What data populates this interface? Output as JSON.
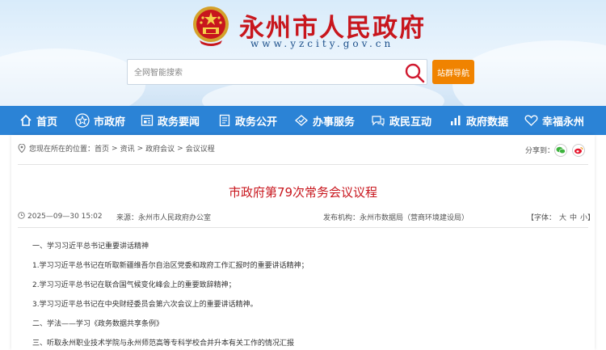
{
  "header": {
    "site_name": "永州市人民政府",
    "site_domain": "www.yzcity.gov.cn",
    "search_placeholder": "全网智能搜索",
    "site_nav_button": "站群导航"
  },
  "nav": [
    {
      "label": "首页",
      "icon": "home-icon"
    },
    {
      "label": "市政府",
      "icon": "star-icon"
    },
    {
      "label": "政务要闻",
      "icon": "news-icon"
    },
    {
      "label": "政务公开",
      "icon": "document-icon"
    },
    {
      "label": "办事服务",
      "icon": "service-icon"
    },
    {
      "label": "政民互动",
      "icon": "chat-icon"
    },
    {
      "label": "政府数据",
      "icon": "data-icon"
    },
    {
      "label": "幸福永州",
      "icon": "heart-icon"
    }
  ],
  "breadcrumb": {
    "prefix": "您现在所在的位置：",
    "items": [
      "首页",
      "资讯",
      "政府会议",
      "会议议程"
    ]
  },
  "share": {
    "label": "分享到："
  },
  "article": {
    "title": "市政府第79次常务会议议程",
    "date": "2025—09—30 15:02",
    "source_label": "来源：",
    "source": "永州市人民政府办公室",
    "publisher_label": "发布机构：",
    "publisher": "永州市数据局（营商环境建设局）",
    "font_label": "【字体：",
    "font_large": "大",
    "font_medium": "中",
    "font_small": "小】",
    "paragraphs": [
      "一、学习习近平总书记重要讲话精神",
      "1.学习习近平总书记在听取新疆维吾尔自治区党委和政府工作汇报时的重要讲话精神；",
      "2.学习习近平总书记在联合国气候变化峰会上的重要致辞精神；",
      "3.学习习近平总书记在中央财经委员会第六次会议上的重要讲话精神。",
      "二、学法——学习《政务数据共享条例》",
      "三、听取永州职业技术学院与永州师范高等专科学校合并升本有关工作的情况汇报"
    ]
  },
  "colors": {
    "nav_bg": "#2b83d6",
    "brand_red": "#c8161d",
    "accent_orange": "#f08300"
  }
}
